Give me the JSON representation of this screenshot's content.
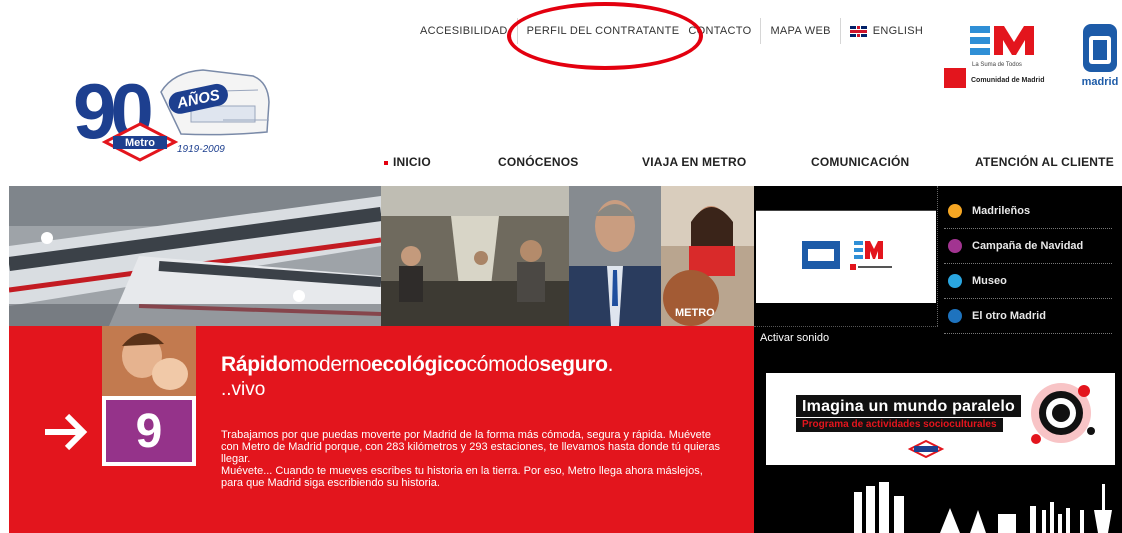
{
  "topnav": {
    "accesibilidad": "ACCESIBILIDAD",
    "perfil": "PERFIL DEL CONTRATANTE",
    "contacto": "CONTACTO",
    "mapa": "MAPA WEB",
    "english": "ENGLISH"
  },
  "logo90": {
    "number": "90",
    "anos": "AÑOS",
    "metro": "Metro",
    "years": "1919-2009"
  },
  "comunidad": {
    "sub": "La Suma de Todos",
    "name": "Comunidad de Madrid"
  },
  "ayto": {
    "name": "madrid"
  },
  "mainnav": {
    "inicio": "INICIO",
    "conocenos": "CONÓCENOS",
    "viaja": "VIAJA EN METRO",
    "comunicacion": "COMUNICACIÓN",
    "atencion": "ATENCIÓN AL CLIENTE"
  },
  "hero": {
    "metro_sign": "METRO"
  },
  "promo": {
    "number": "9",
    "w1": "Rápido",
    "w2": "moderno",
    "w3": "ecológico",
    "w4": "cómodo",
    "w5": "seguro",
    "dot": ".",
    "sub": "..vivo",
    "p1": "Trabajamos por que puedas moverte por Madrid de la forma más cómoda, segura y rápida. Muévete con Metro de Madrid porque, con 283 kilómetros y 293 estaciones, te llevamos hasta donde tú quieras llegar.",
    "p2": "Muévete... Cuando te mueves escribes tu historia en la tierra. Por eso, Metro llega ahora máslejos, para que Madrid siga escribiendo su historia."
  },
  "side_menu": [
    {
      "label": "Madrileños",
      "color": "#f5a623"
    },
    {
      "label": "Campaña de Navidad",
      "color": "#a23491"
    },
    {
      "label": "Museo",
      "color": "#2aa6e0"
    },
    {
      "label": "El otro Madrid",
      "color": "#1e73be"
    }
  ],
  "activar": "Activar sonido",
  "banner": {
    "title": "Imagina un mundo paralelo",
    "sub": "Programa de actividades socioculturales",
    "metro": "Metro"
  },
  "colors": {
    "metro_red": "#e3151d",
    "metro_blue": "#1d3f8f",
    "purple": "#95338a"
  }
}
